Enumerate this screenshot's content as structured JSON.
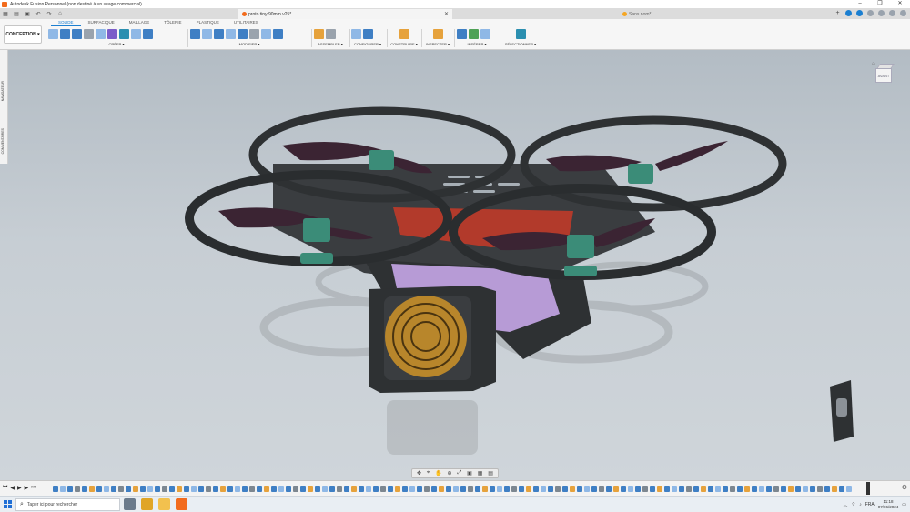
{
  "window": {
    "title": "Autodesk Fusion Personnel (non destiné à un usage commercial)",
    "controls": [
      "–",
      "❐",
      "✕"
    ]
  },
  "tabs": {
    "active": "proto tiny 90mm v25*",
    "inactive": "Sans nom*"
  },
  "ribbon": {
    "design_button": "CONCEPTION ▾",
    "tabs": [
      "SOLIDE",
      "SURFACIQUE",
      "MAILLAGE",
      "TÔLERIE",
      "PLASTIQUE",
      "UTILITAIRES"
    ],
    "groups": [
      "CRÉER ▾",
      "MODIFIER ▾",
      "ASSEMBLER ▾",
      "CONFIGURER ▾",
      "CONSTRUIRE ▾",
      "INSPECTER ▾",
      "INSÉRER ▾",
      "SÉLECTIONNER ▾"
    ]
  },
  "side_panel": {
    "navigator": "NAVIGATEUR",
    "comments": "COMMENTAIRES"
  },
  "viewcube": {
    "face": "AVANT"
  },
  "taskbar": {
    "search_placeholder": "Taper ici pour rechercher",
    "language": "FRA",
    "time": "11:18",
    "date": "07/06/2024"
  },
  "colors": {
    "accent": "#1b7fd1",
    "frame": "#2e3133",
    "propeller": "#3b2433",
    "motor": "#3b8c78",
    "battery": "#b79bd6",
    "electronics": "#b23a2b",
    "camera_lens": "#b8862b"
  }
}
